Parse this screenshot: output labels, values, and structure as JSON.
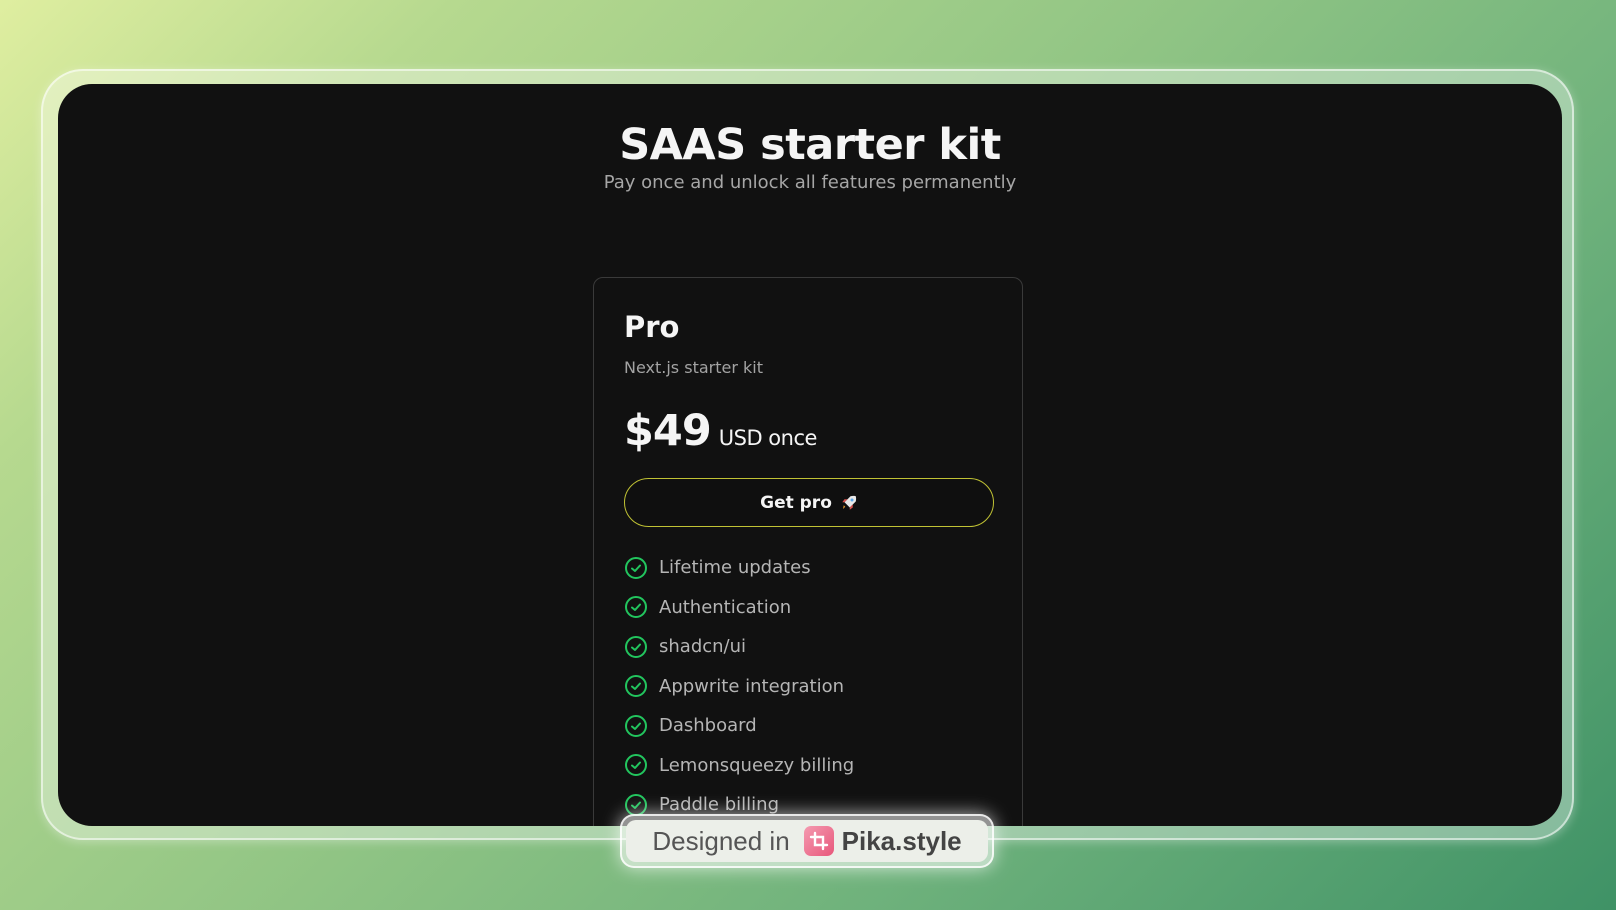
{
  "header": {
    "title": "SAAS starter kit",
    "subtitle": "Pay once and unlock all features permanently"
  },
  "plan": {
    "name": "Pro",
    "description": "Next.js starter kit",
    "price": "$49",
    "price_suffix": "USD once",
    "cta_label": "Get pro",
    "cta_icon": "rocket-icon",
    "features": [
      "Lifetime updates",
      "Authentication",
      "shadcn/ui",
      "Appwrite integration",
      "Dashboard",
      "Lemonsqueezy billing",
      "Paddle billing"
    ]
  },
  "watermark": {
    "prefix": "Designed in",
    "brand": "Pika.style"
  },
  "colors": {
    "background": "#111111",
    "accent_border": "#c0c234",
    "check": "#22c55e",
    "text": "#f5f5f5",
    "muted_text": "#a6a6a6"
  }
}
